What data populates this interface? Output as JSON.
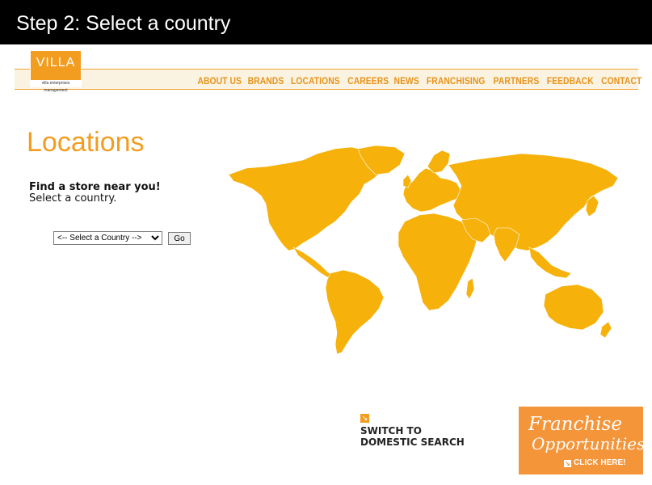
{
  "step": {
    "title": "Step 2: Select a country"
  },
  "logo": {
    "word": "VILLA",
    "tagline": "villa enterprises management"
  },
  "nav": {
    "items": [
      "ABOUT US",
      "BRANDS",
      "LOCATIONS",
      "CAREERS",
      "NEWS",
      "FRANCHISING",
      "PARTNERS",
      "FEEDBACK",
      "CONTACT"
    ]
  },
  "main": {
    "title": "Locations",
    "find_title": "Find a store near you!",
    "find_sub": "Select a country.",
    "select_value": "<-- Select a Country -->",
    "go_label": "Go"
  },
  "switch": {
    "line1": "SWITCH TO",
    "line2": "DOMESTIC SEARCH",
    "icon": "arrow-icon"
  },
  "franchise": {
    "line1": "Franchise",
    "line2": "Opportunities",
    "cta": "CLICK HERE!"
  },
  "colors": {
    "accent": "#f29d1f",
    "map": "#f6b10a",
    "band": "#fbf3e1",
    "step_bar": "#000000"
  }
}
